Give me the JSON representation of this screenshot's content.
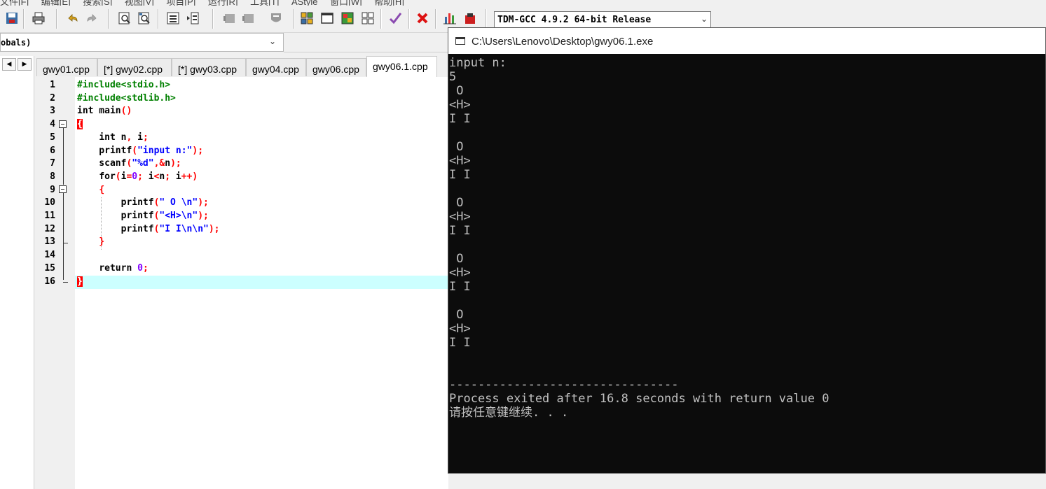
{
  "menubar": {
    "items": [
      "文件[F]",
      "编辑[E]",
      "搜索[S]",
      "视图[V]",
      "项目[P]",
      "运行[R]",
      "工具[T]",
      "AStyle",
      "窗口[W]",
      "帮助[H]"
    ]
  },
  "toolbar": {
    "icons": [
      "save-icon",
      "print-icon",
      "undo-icon",
      "redo-icon",
      "find-icon",
      "replace-icon",
      "goto-icon",
      "indent-icon",
      "compile-icon",
      "run-icon",
      "compile-run-icon",
      "rebuild-icon",
      "check-icon",
      "stop-icon",
      "chart-icon",
      "debug-icon"
    ],
    "compiler": "TDM-GCC 4.9.2 64-bit Release"
  },
  "globals": {
    "label": "obals)"
  },
  "tabs": [
    "gwy01.cpp",
    "[*] gwy02.cpp",
    "[*] gwy03.cpp",
    "gwy04.cpp",
    "gwy06.cpp",
    "gwy06.1.cpp"
  ],
  "active_tab": "gwy06.1.cpp",
  "editor": {
    "line_numbers": [
      "1",
      "2",
      "3",
      "4",
      "5",
      "6",
      "7",
      "8",
      "9",
      "10",
      "11",
      "12",
      "13",
      "14",
      "15",
      "16"
    ]
  },
  "console": {
    "title": "C:\\Users\\Lenovo\\Desktop\\gwy06.1.exe",
    "lines": [
      "input n:",
      "5",
      " O",
      "<H>",
      "I I",
      "",
      " O",
      "<H>",
      "I I",
      "",
      " O",
      "<H>",
      "I I",
      "",
      " O",
      "<H>",
      "I I",
      "",
      " O",
      "<H>",
      "I I",
      "",
      "",
      "--------------------------------",
      "Process exited after 16.8 seconds with return value 0",
      "请按任意键继续. . ."
    ]
  },
  "colors": {
    "preprocessor": "#008000",
    "string": "#0000ff",
    "symbol": "#ff0000",
    "number": "#8000ff",
    "current_line": "#ccffff",
    "console_bg": "#0c0c0c",
    "console_fg": "#c0c0c0"
  }
}
